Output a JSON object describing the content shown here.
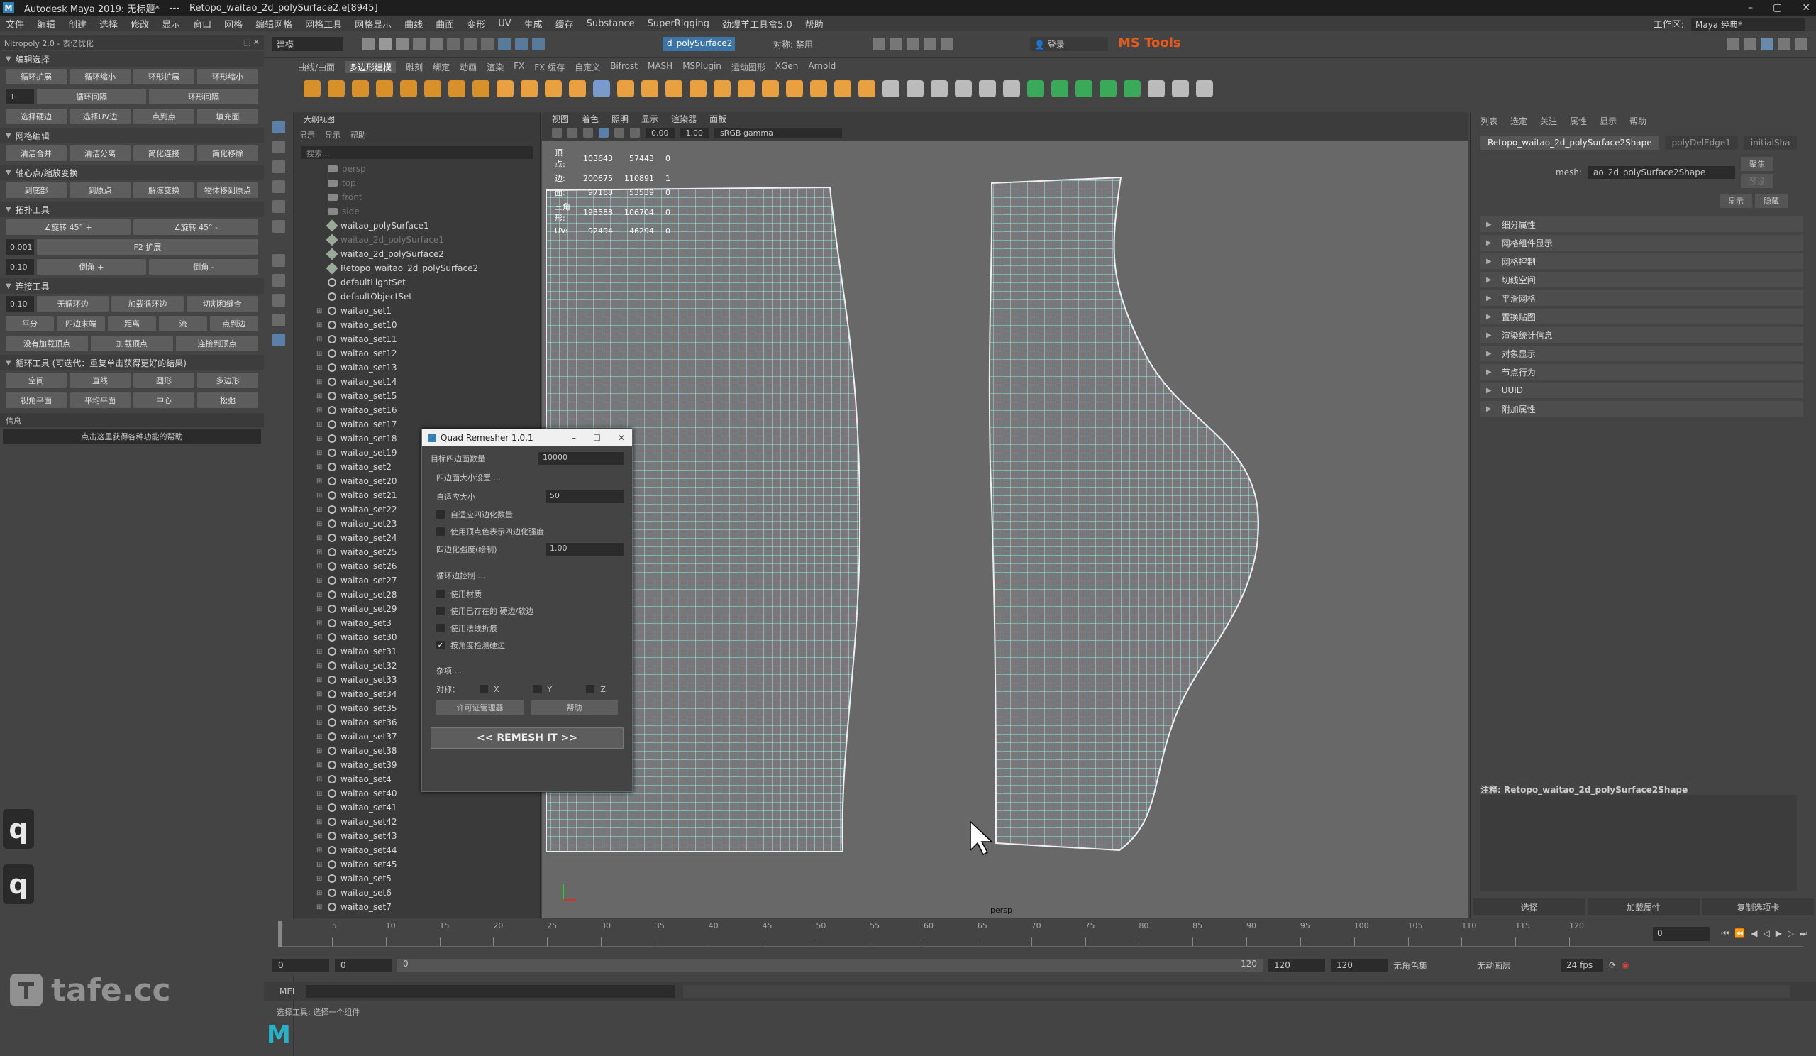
{
  "app": {
    "title": "Autodesk Maya 2019: 无标题*",
    "file": "Retopo_waitao_2d_polySurface2.e[8945]"
  },
  "menus": [
    "文件",
    "编辑",
    "创建",
    "选择",
    "修改",
    "显示",
    "窗口",
    "网格",
    "编辑网格",
    "网格工具",
    "网格显示",
    "曲线",
    "曲面",
    "变形",
    "UV",
    "生成",
    "缓存",
    "Substance",
    "SuperRigging",
    "劲爆羊工具盒5.0",
    "帮助"
  ],
  "workspace": {
    "label": "工作区:",
    "value": "Maya 经典*"
  },
  "statusline": {
    "mode": "建模",
    "selection": "d_polySurface2",
    "symmetry": "对称: 禁用",
    "login": "登录",
    "mstools": "MS Tools"
  },
  "left": {
    "header": "Nitropoly 2.0 - 表亿优化",
    "sections": [
      {
        "title": "编辑选择",
        "rows": [
          [
            "循环扩展",
            "循环缩小",
            "环形扩展",
            "环形缩小"
          ],
          [
            "#1",
            "循环间隔",
            "环形间隔"
          ],
          [
            "选择硬边",
            "选择UV边",
            "点到点",
            "填充面"
          ]
        ]
      },
      {
        "title": "网格编辑",
        "rows": [
          [
            "清洁合并",
            "清洁分离",
            "简化连接",
            "简化移除"
          ]
        ]
      },
      {
        "title": "轴心点/缩放变换",
        "rows": [
          [
            "到底部",
            "到原点",
            "解冻变换",
            "物体移到原点"
          ]
        ]
      },
      {
        "title": "拓扑工具",
        "rows": [
          [
            "∠旋转 45° +",
            "∠旋转 45° -"
          ],
          [
            "#0.001",
            "F2 扩展"
          ],
          [
            "#0.10",
            "倒角 +",
            "倒角 -"
          ]
        ]
      },
      {
        "title": "连接工具",
        "rows": [
          [
            "#0.10",
            "无循环边",
            "加载循环边",
            "切割和缝合"
          ],
          [
            "平分",
            "四边末端",
            "距离",
            "流",
            "点到边"
          ],
          [
            "没有加载顶点",
            "加载顶点",
            "连接到顶点"
          ]
        ]
      },
      {
        "title": "循环工具 (可迭代：重复单击获得更好的结果)",
        "rows": [
          [
            "空间",
            "直线",
            "圆形",
            "多边形"
          ],
          [
            "视角平面",
            "平均平面",
            "中心",
            "松弛"
          ]
        ]
      }
    ],
    "info": "信息",
    "help": "点击这里获得各种功能的帮助",
    "keys": [
      "q",
      "q"
    ],
    "watermark": "tafe.cc"
  },
  "shelf": {
    "tabs": [
      "曲线/曲面",
      "多边形建模",
      "雕刻",
      "绑定",
      "动画",
      "渲染",
      "FX",
      "FX 缓存",
      "自定义",
      "Bifrost",
      "MASH",
      "MSPlugin",
      "运动图形",
      "XGen",
      "Arnold"
    ],
    "active": 1
  },
  "outliner": {
    "title": "大纲视图",
    "menu": [
      "显示",
      "显示",
      "帮助"
    ],
    "search": "搜索...",
    "cameras": [
      "persp",
      "top",
      "front",
      "side"
    ],
    "meshes": [
      {
        "name": "waitao_polySurface1",
        "dim": false
      },
      {
        "name": "waitao_2d_polySurface1",
        "dim": true
      },
      {
        "name": "waitao_2d_polySurface2",
        "dim": false
      },
      {
        "name": "Retopo_waitao_2d_polySurface2",
        "dim": false
      }
    ],
    "sets": [
      "defaultLightSet",
      "defaultObjectSet"
    ],
    "waitao_sets": [
      "waitao_set1",
      "waitao_set10",
      "waitao_set11",
      "waitao_set12",
      "waitao_set13",
      "waitao_set14",
      "waitao_set15",
      "waitao_set16",
      "waitao_set17",
      "waitao_set18",
      "waitao_set19",
      "waitao_set2",
      "waitao_set20",
      "waitao_set21",
      "waitao_set22",
      "waitao_set23",
      "waitao_set24",
      "waitao_set25",
      "waitao_set26",
      "waitao_set27",
      "waitao_set28",
      "waitao_set29",
      "waitao_set3",
      "waitao_set30",
      "waitao_set31",
      "waitao_set32",
      "waitao_set33",
      "waitao_set34",
      "waitao_set35",
      "waitao_set36",
      "waitao_set37",
      "waitao_set38",
      "waitao_set39",
      "waitao_set4",
      "waitao_set40",
      "waitao_set41",
      "waitao_set42",
      "waitao_set43",
      "waitao_set44",
      "waitao_set45",
      "waitao_set5",
      "waitao_set6",
      "waitao_set7"
    ]
  },
  "viewport": {
    "menu": [
      "视图",
      "着色",
      "照明",
      "显示",
      "渲染器",
      "面板"
    ],
    "exposure": "0.00",
    "gamma": "1.00",
    "colorspace": "sRGB gamma",
    "hud": [
      [
        "顶点:",
        "103643",
        "57443",
        "0"
      ],
      [
        "边:",
        "200675",
        "110891",
        "1"
      ],
      [
        "面:",
        "97168",
        "53539",
        "0"
      ],
      [
        "三角形:",
        "193588",
        "106704",
        "0"
      ],
      [
        "UV:",
        "92494",
        "46294",
        "0"
      ]
    ],
    "camera": "persp"
  },
  "dialog": {
    "title": "Quad Remesher 1.0.1",
    "target_label": "目标四边面数量",
    "target_value": "10000",
    "size_hdr": "四边面大小设置 ...",
    "adaptive_label": "自适应大小",
    "adaptive_value": "50",
    "checks1": [
      {
        "label": "自适应四边化数量",
        "on": false
      },
      {
        "label": "使用顶点色表示四边化强度",
        "on": false
      }
    ],
    "density_label": "四边化强度(绘制)",
    "density_value": "1.00",
    "loop_hdr": "循环边控制 ...",
    "checks2": [
      {
        "label": "使用材质",
        "on": false
      },
      {
        "label": "使用已存在的 硬边/软边",
        "on": false
      },
      {
        "label": "使用法线折痕",
        "on": false
      },
      {
        "label": "按角度检测硬边",
        "on": true
      }
    ],
    "misc_hdr": "杂项 ...",
    "sym_label": "对称：",
    "axes": [
      "X",
      "Y",
      "Z"
    ],
    "license": "许可证管理器",
    "help": "帮助",
    "remesh": "<<   REMESH IT   >>"
  },
  "attr": {
    "menu": [
      "列表",
      "选定",
      "关注",
      "属性",
      "显示",
      "帮助"
    ],
    "tabs": [
      "Retopo_waitao_2d_polySurface2Shape",
      "polyDelEdge1",
      "initialSha"
    ],
    "mesh_label": "mesh:",
    "mesh_value": "ao_2d_polySurface2Shape",
    "btns": [
      "聚焦",
      "预设",
      "显示",
      "隐藏"
    ],
    "sections": [
      "细分属性",
      "网格组件显示",
      "网格控制",
      "切线空间",
      "平滑网格",
      "置换贴图",
      "渲染统计信息",
      "对象显示",
      "节点行为",
      "UUID",
      "附加属性"
    ],
    "notes": "注释: Retopo_waitao_2d_polySurface2Shape",
    "bottom": [
      "选择",
      "加载属性",
      "复制选项卡"
    ]
  },
  "timeline": {
    "ticks": [
      "0",
      "5",
      "10",
      "15",
      "20",
      "25",
      "30",
      "35",
      "40",
      "45",
      "50",
      "55",
      "60",
      "65",
      "70",
      "75",
      "80",
      "85",
      "90",
      "95",
      "100",
      "105",
      "110",
      "115",
      "120"
    ],
    "current": "0"
  },
  "range": {
    "start": "0",
    "start2": "0",
    "anim_start": "0",
    "end": "120",
    "end2": "120",
    "end3": "120",
    "charset": "无角色集",
    "layer": "无动画层",
    "fps": "24 fps"
  },
  "mel": {
    "label": "MEL",
    "help": "选择工具: 选择一个组件"
  }
}
